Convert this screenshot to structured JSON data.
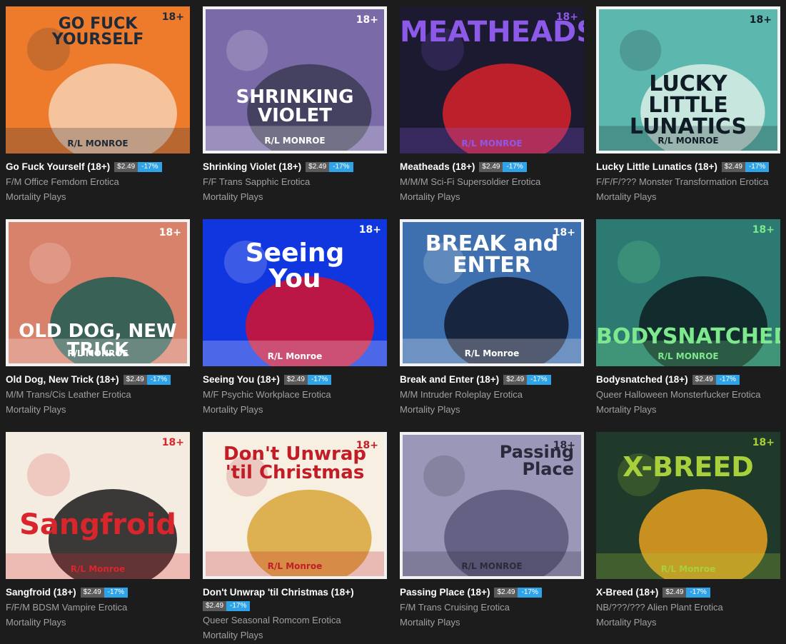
{
  "author": "Mortality Plays",
  "price": "$2.49",
  "discount": "-17%",
  "items": [
    {
      "title": "Go Fuck Yourself (18+)",
      "desc": "F/M Office Femdom Erotica",
      "cover_title": "GO FUCK\nYOURSELF",
      "cover_sub": "R/L MONROE",
      "cover_age": "18+",
      "colors": {
        "bg": "#ee7b2c",
        "fg": "#1d2a3a",
        "accent": "#f6d0b0"
      }
    },
    {
      "title": "Shrinking Violet (18+)",
      "desc": "F/F Trans Sapphic Erotica",
      "cover_title": "SHRINKING\nVIOLET",
      "cover_sub": "R/L MONROE",
      "cover_age": "18+",
      "colors": {
        "bg": "#7a6aa8",
        "fg": "#ffffff",
        "accent": "#3c3b55"
      }
    },
    {
      "title": "Meatheads (18+)",
      "desc": "M/M/M Sci-Fi Supersoldier Erotica",
      "cover_title": "MEATHEADS",
      "cover_sub": "R/L MONROE",
      "cover_age": "18+",
      "colors": {
        "bg": "#1b1a30",
        "fg": "#8c59e8",
        "accent": "#d8232a"
      }
    },
    {
      "title": "Lucky Little Lunatics (18+)",
      "desc": "F/F/F/??? Monster Transformation Erotica",
      "cover_title": "LUCKY\nLITTLE\nLUNATICS",
      "cover_sub": "R/L MONROE",
      "cover_age": "18+",
      "colors": {
        "bg": "#5cb8ae",
        "fg": "#0f1c25",
        "accent": "#d9efe6"
      }
    },
    {
      "title": "Old Dog, New Trick (18+)",
      "desc": "M/M Trans/Cis Leather Erotica",
      "cover_title": "OLD DOG, NEW TRICK",
      "cover_sub": "R/L MONROE",
      "cover_age": "18+",
      "colors": {
        "bg": "#d8826b",
        "fg": "#ffffff",
        "accent": "#1e5c52"
      }
    },
    {
      "title": "Seeing You (18+)",
      "desc": "M/F Psychic Workplace Erotica",
      "cover_title": "Seeing\nYou",
      "cover_sub": "R/L Monroe",
      "cover_age": "18+",
      "colors": {
        "bg": "#1036e0",
        "fg": "#ffffff",
        "accent": "#d8102a"
      }
    },
    {
      "title": "Break and Enter (18+)",
      "desc": "M/M Intruder Roleplay Erotica",
      "cover_title": "BREAK and ENTER",
      "cover_sub": "R/L Monroe",
      "cover_age": "18+",
      "colors": {
        "bg": "#3e6fae",
        "fg": "#ffffff",
        "accent": "#12192c"
      }
    },
    {
      "title": "Bodysnatched (18+)",
      "desc": "Queer Halloween Monsterfucker Erotica",
      "cover_title": "BODYSNATCHED",
      "cover_sub": "R/L MONROE",
      "cover_age": "18+",
      "colors": {
        "bg": "#2d7a73",
        "fg": "#7de88c",
        "accent": "#0e1e22"
      }
    },
    {
      "title": "Sangfroid (18+)",
      "desc": "F/F/M BDSM Vampire Erotica",
      "cover_title": "Sangfroid",
      "cover_sub": "R/L Monroe",
      "cover_age": "18+",
      "colors": {
        "bg": "#f4ece0",
        "fg": "#d8262c",
        "accent": "#1a1a1a"
      }
    },
    {
      "title": "Don't Unwrap 'til Christmas (18+)",
      "desc": "Queer Seasonal Romcom Erotica",
      "cover_title": "Don't Unwrap\n'til Christmas",
      "cover_sub": "R/L Monroe",
      "cover_age": "18+",
      "colors": {
        "bg": "#f6efe2",
        "fg": "#c21d26",
        "accent": "#d8a638"
      }
    },
    {
      "title": "Passing Place (18+)",
      "desc": "F/M Trans Cruising Erotica",
      "cover_title": "Passing\nPlace",
      "cover_sub": "R/L MONROE",
      "cover_age": "18+",
      "colors": {
        "bg": "#9a97b8",
        "fg": "#2a2a3a",
        "accent": "#5a577a"
      }
    },
    {
      "title": "X-Breed (18+)",
      "desc": "NB/???/??? Alien Plant Erotica",
      "cover_title": "X-BREED",
      "cover_sub": "R/L Monroe",
      "cover_age": "18+",
      "colors": {
        "bg": "#1f3a2a",
        "fg": "#a8d03a",
        "accent": "#e6a020"
      }
    }
  ]
}
